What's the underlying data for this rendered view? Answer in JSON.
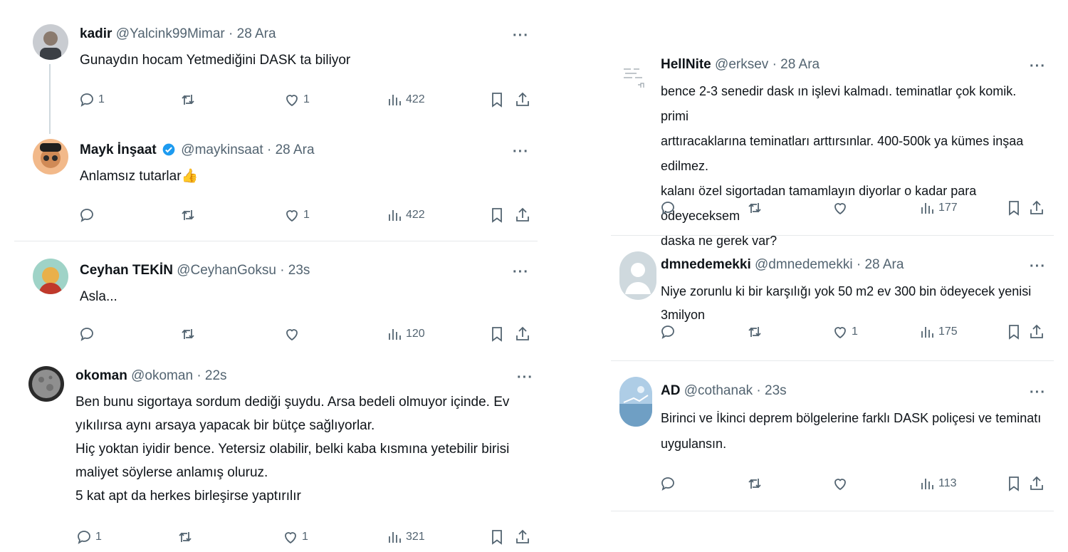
{
  "left": {
    "tweets": [
      {
        "name": "kadir",
        "handle": "@Yalcink99Mimar",
        "sep": "·",
        "time": "28 Ara",
        "more": "···",
        "lines": [
          "Gunaydın hocam Yetmediğini DASK ta biliyor"
        ],
        "reply_count": "1",
        "retweet_count": "",
        "like_count": "1",
        "view_count": "422"
      },
      {
        "name": "Mayk İnşaat",
        "handle": "@maykinsaat",
        "sep": "·",
        "time": "28 Ara",
        "more": "···",
        "lines": [
          "Anlamsız tutarlar👍"
        ],
        "reply_count": "",
        "retweet_count": "",
        "like_count": "1",
        "view_count": "422"
      },
      {
        "name": "Ceyhan TEKİN",
        "handle": "@CeyhanGoksu",
        "sep": "·",
        "time": "23s",
        "more": "···",
        "lines": [
          "Asla..."
        ],
        "reply_count": "",
        "retweet_count": "",
        "like_count": "",
        "view_count": "120"
      },
      {
        "name": "okoman",
        "handle": "@okoman",
        "sep": "·",
        "time": "22s",
        "more": "···",
        "lines": [
          "Ben bunu sigortaya sordum  dediği şuydu. Arsa bedeli olmuyor içinde. Ev",
          "yıkılırsa aynı arsaya yapacak bir bütçe sağlıyorlar.",
          "Hiç yoktan iyidir bence. Yetersiz olabilir, belki kaba kısmına yetebilir birisi",
          "maliyet söylerse anlamış oluruz.",
          "5 kat apt da herkes birleşirse yaptırılır"
        ],
        "reply_count": "1",
        "retweet_count": "",
        "like_count": "1",
        "view_count": "321"
      }
    ]
  },
  "right": {
    "tweets": [
      {
        "name": "HellNite",
        "handle": "@erksev",
        "sep": "·",
        "time": "28 Ara",
        "more": "···",
        "lines": [
          "bence 2-3 senedir dask ın işlevi kalmadı. teminatlar çok komik. primi",
          "arttıracaklarına teminatları arttırsınlar. 400-500k ya kümes inşaa edilmez.",
          "kalanı özel sigortadan tamamlayın diyorlar o kadar para ödeyeceksem",
          "daska ne gerek var?"
        ],
        "reply_count": "",
        "retweet_count": "",
        "like_count": "",
        "view_count": "177"
      },
      {
        "name": "dmnedemekki",
        "handle": "@dmnedemekki",
        "sep": "·",
        "time": "28 Ara",
        "more": "···",
        "lines": [
          "Niye zorunlu ki bir karşılığı yok 50 m2 ev 300 bin ödeyecek yenisi 3milyon"
        ],
        "reply_count": "",
        "retweet_count": "",
        "like_count": "1",
        "view_count": "175"
      },
      {
        "name": "AD",
        "handle": "@cothanak",
        "sep": "·",
        "time": "23s",
        "more": "···",
        "lines": [
          "Birinci ve İkinci deprem bölgelerine farklı DASK poliçesi ve teminatı",
          "uygulansın."
        ],
        "reply_count": "",
        "retweet_count": "",
        "like_count": "",
        "view_count": "113"
      }
    ]
  },
  "icons": {
    "reply": "reply-icon",
    "retweet": "retweet-icon",
    "like": "like-icon",
    "views": "views-icon",
    "bookmark": "bookmark-icon",
    "share": "share-icon",
    "verified": "verified-badge-icon"
  },
  "colors": {
    "text": "#0f1419",
    "secondary": "#536471",
    "verified": "#1d9bf0",
    "divider": "#e6e9eb"
  }
}
